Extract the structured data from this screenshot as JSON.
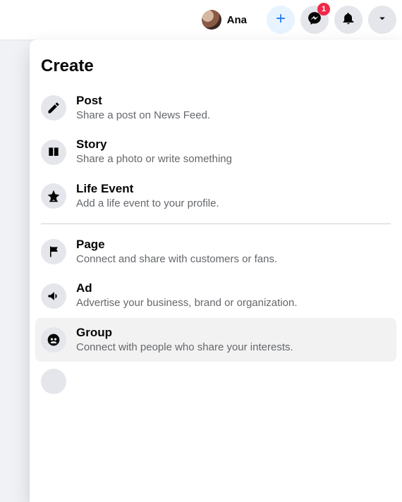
{
  "header": {
    "profile_name": "Ana",
    "messenger_badge": "1"
  },
  "panel": {
    "title": "Create",
    "section1": [
      {
        "title": "Post",
        "sub": "Share a post on News Feed."
      },
      {
        "title": "Story",
        "sub": "Share a photo or write something"
      },
      {
        "title": "Life Event",
        "sub": "Add a life event to your profile."
      }
    ],
    "section2": [
      {
        "title": "Page",
        "sub": "Connect and share with customers or fans."
      },
      {
        "title": "Ad",
        "sub": "Advertise your business, brand or organization."
      },
      {
        "title": "Group",
        "sub": "Connect with people who share your interests."
      }
    ]
  }
}
